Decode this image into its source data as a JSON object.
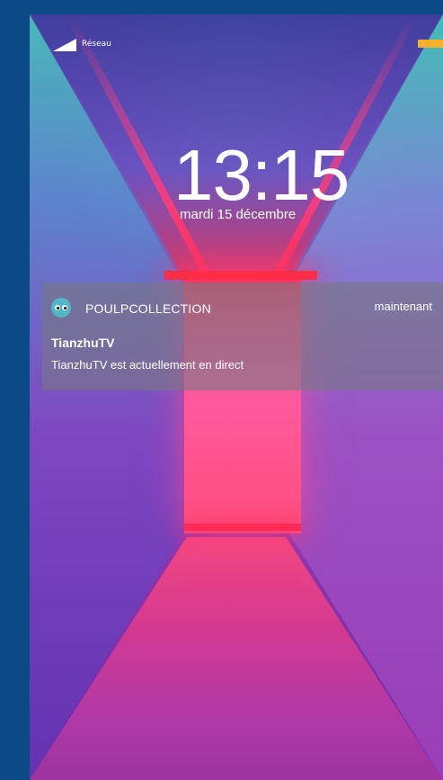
{
  "status_bar": {
    "network_label": "Réseau",
    "signal_icon": "signal-icon",
    "battery_icon": "battery-icon",
    "battery_color": "#f6b02a"
  },
  "lockscreen": {
    "time": "13:15",
    "date": "mardi 15 décembre"
  },
  "notification": {
    "app_icon": "owl-eyes-icon",
    "app_name": "POULPCOLLECTION",
    "time": "maintenant",
    "title": "TianzhuTV",
    "body": "TianzhuTV est actuellement en direct"
  },
  "colors": {
    "page_background": "#0b4a87",
    "notification_background": "rgba(120,120,130,0.62)",
    "app_icon_color": "#4fb8c4"
  }
}
